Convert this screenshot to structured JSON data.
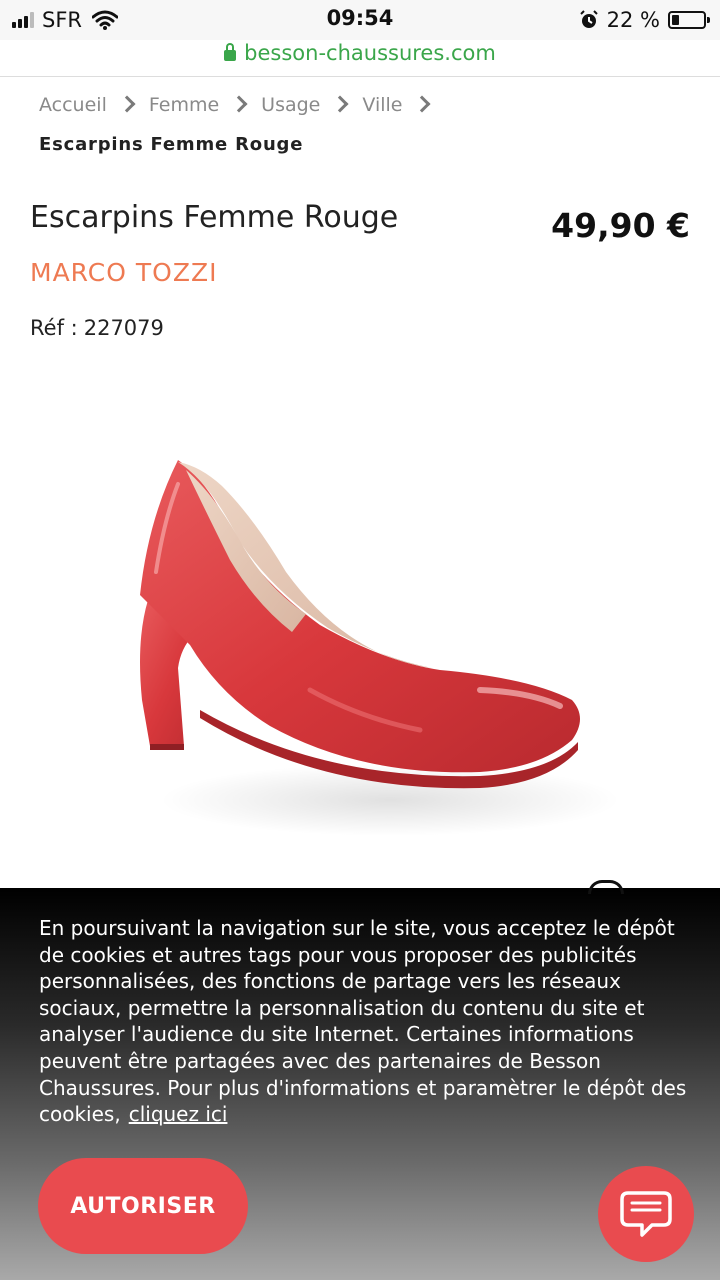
{
  "status_bar": {
    "carrier": "SFR",
    "time": "09:54",
    "battery": "22 %",
    "battery_level": 0.22,
    "url": "besson-chaussures.com"
  },
  "breadcrumb": {
    "items": [
      "Accueil",
      "Femme",
      "Usage",
      "Ville"
    ],
    "current": "Escarpins Femme Rouge"
  },
  "product": {
    "title": "Escarpins Femme Rouge",
    "price": "49,90 €",
    "brand": "MARCO TOZZI",
    "ref_label": "Réf :",
    "ref_value": "227079",
    "color_shoe": "#d83a3e",
    "color_brand": "#ee7a52"
  },
  "cookie_banner": {
    "text": "En poursuivant la navigation sur le site, vous acceptez le dépôt de cookies et autres tags pour vous proposer des publicités personnalisées, des fonctions de partage vers les réseaux sociaux, permettre la personnalisation du contenu du site et analyser l'audience du site Internet. Certaines informations peuvent être partagées avec des partenaires de Besson Chaussures. Pour plus d'informations et paramètrer le dépôt des cookies,",
    "link": "cliquez ici",
    "button": "AUTORISER",
    "accent": "#e94b4f"
  },
  "icons": {
    "chat": "chat-bubble-icon",
    "lock": "lock-icon",
    "wifi": "wifi-icon",
    "alarm": "alarm-icon"
  }
}
